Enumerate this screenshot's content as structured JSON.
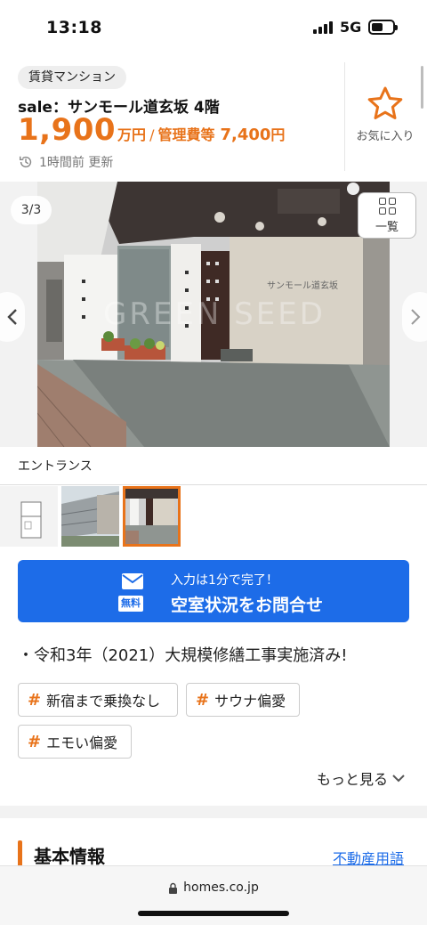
{
  "status": {
    "time": "13:18",
    "network": "5G"
  },
  "listing": {
    "type_badge": "賃貸マンション",
    "title": "sale：サンモール道玄坂 4階",
    "rent_value": "1,900",
    "rent_unit": "万円",
    "separator": "/",
    "mgmt_label": "管理費等",
    "mgmt_value": "7,400",
    "mgmt_unit": "円",
    "updated": "1時間前 更新",
    "favorite_label": "お気に入り"
  },
  "gallery": {
    "counter": "3/3",
    "list_button_label": "一覧",
    "caption": "エントランス",
    "watermark": "GREEN SEED",
    "sign_text": "サンモール道玄坂",
    "thumbnails": [
      "floor-plan",
      "building-exterior",
      "entrance"
    ],
    "active_thumbnail": 3
  },
  "cta": {
    "sub": "入力は1分で完了！",
    "main": "空室状況をお問合せ",
    "free_badge": "無料"
  },
  "highlight": "・令和3年（2021）大規模修繕工事実施済み!",
  "tags": [
    "新宿まで乗換なし",
    "サウナ偏愛",
    "エモい偏愛"
  ],
  "tag_hash": "#",
  "more_label": "もっと見る",
  "section": {
    "title": "基本情報",
    "glossary_link": "不動産用語"
  },
  "browser": {
    "url": "homes.co.jp"
  },
  "colors": {
    "accent": "#e8731a",
    "primary": "#1d6ce8"
  }
}
